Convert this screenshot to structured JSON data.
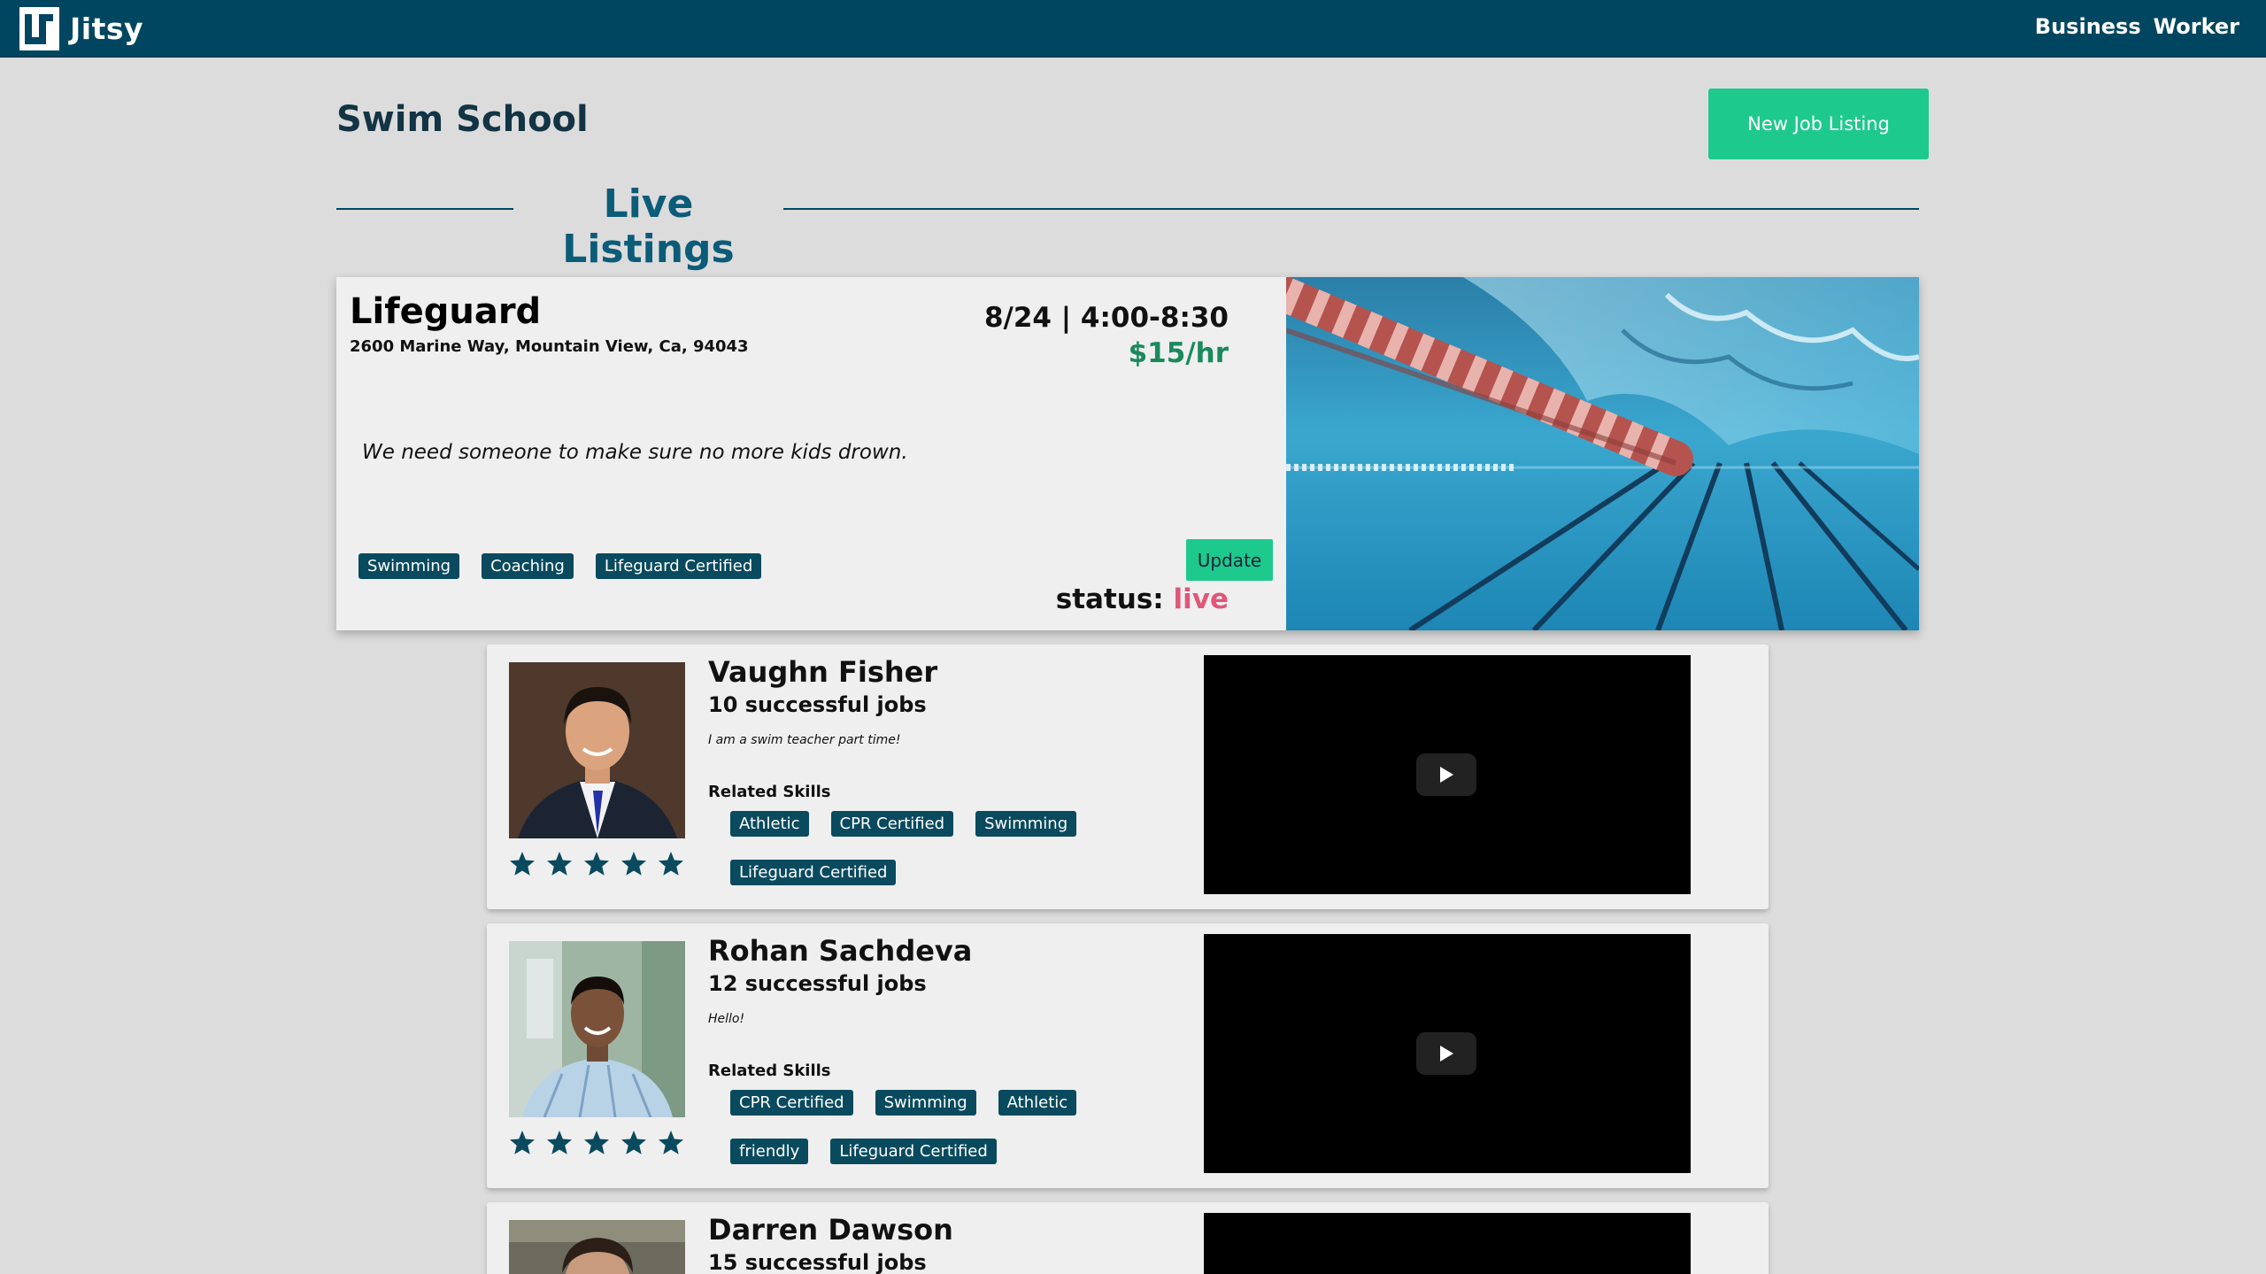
{
  "nav": {
    "brand": "Jitsy",
    "links": [
      "Business",
      "Worker"
    ]
  },
  "header": {
    "title": "Swim School",
    "new_listing_label": "New Job Listing",
    "section_title": "Live Listings"
  },
  "listing": {
    "title": "Lifeguard",
    "address": "2600 Marine Way, Mountain View, Ca, 94043",
    "datetime": "8/24 | 4:00-8:30",
    "pay": "$15/hr",
    "description": "We need someone to make sure no more kids drown.",
    "tags": [
      "Swimming",
      "Coaching",
      "Lifeguard Certified"
    ],
    "update_label": "Update",
    "status_label": "status:",
    "status_value": "live",
    "image_icon": "pool-lane-photo"
  },
  "applicants": [
    {
      "name": "Vaughn Fisher",
      "jobs": "10 successful jobs",
      "bio": "I am a swim teacher part time!",
      "skills_heading": "Related Skills",
      "skills_row1": [
        "Athletic",
        "CPR Certified",
        "Swimming"
      ],
      "skills_row2": [
        "Lifeguard Certified"
      ],
      "rating": 5
    },
    {
      "name": "Rohan Sachdeva",
      "jobs": "12 successful jobs",
      "bio": "Hello!",
      "skills_heading": "Related Skills",
      "skills_row1": [
        "CPR Certified",
        "Swimming",
        "Athletic"
      ],
      "skills_row2": [
        "friendly",
        "Lifeguard Certified"
      ],
      "rating": 5
    },
    {
      "name": "Darren Dawson",
      "jobs": "15 successful jobs"
    }
  ],
  "colors": {
    "nav_bg": "#004660",
    "accent_green": "#1ec98e",
    "tag_bg": "#0a4a5e",
    "pay_green": "#1a8a5d",
    "status_pink": "#e0567a",
    "page_bg": "#dcdcdc"
  }
}
